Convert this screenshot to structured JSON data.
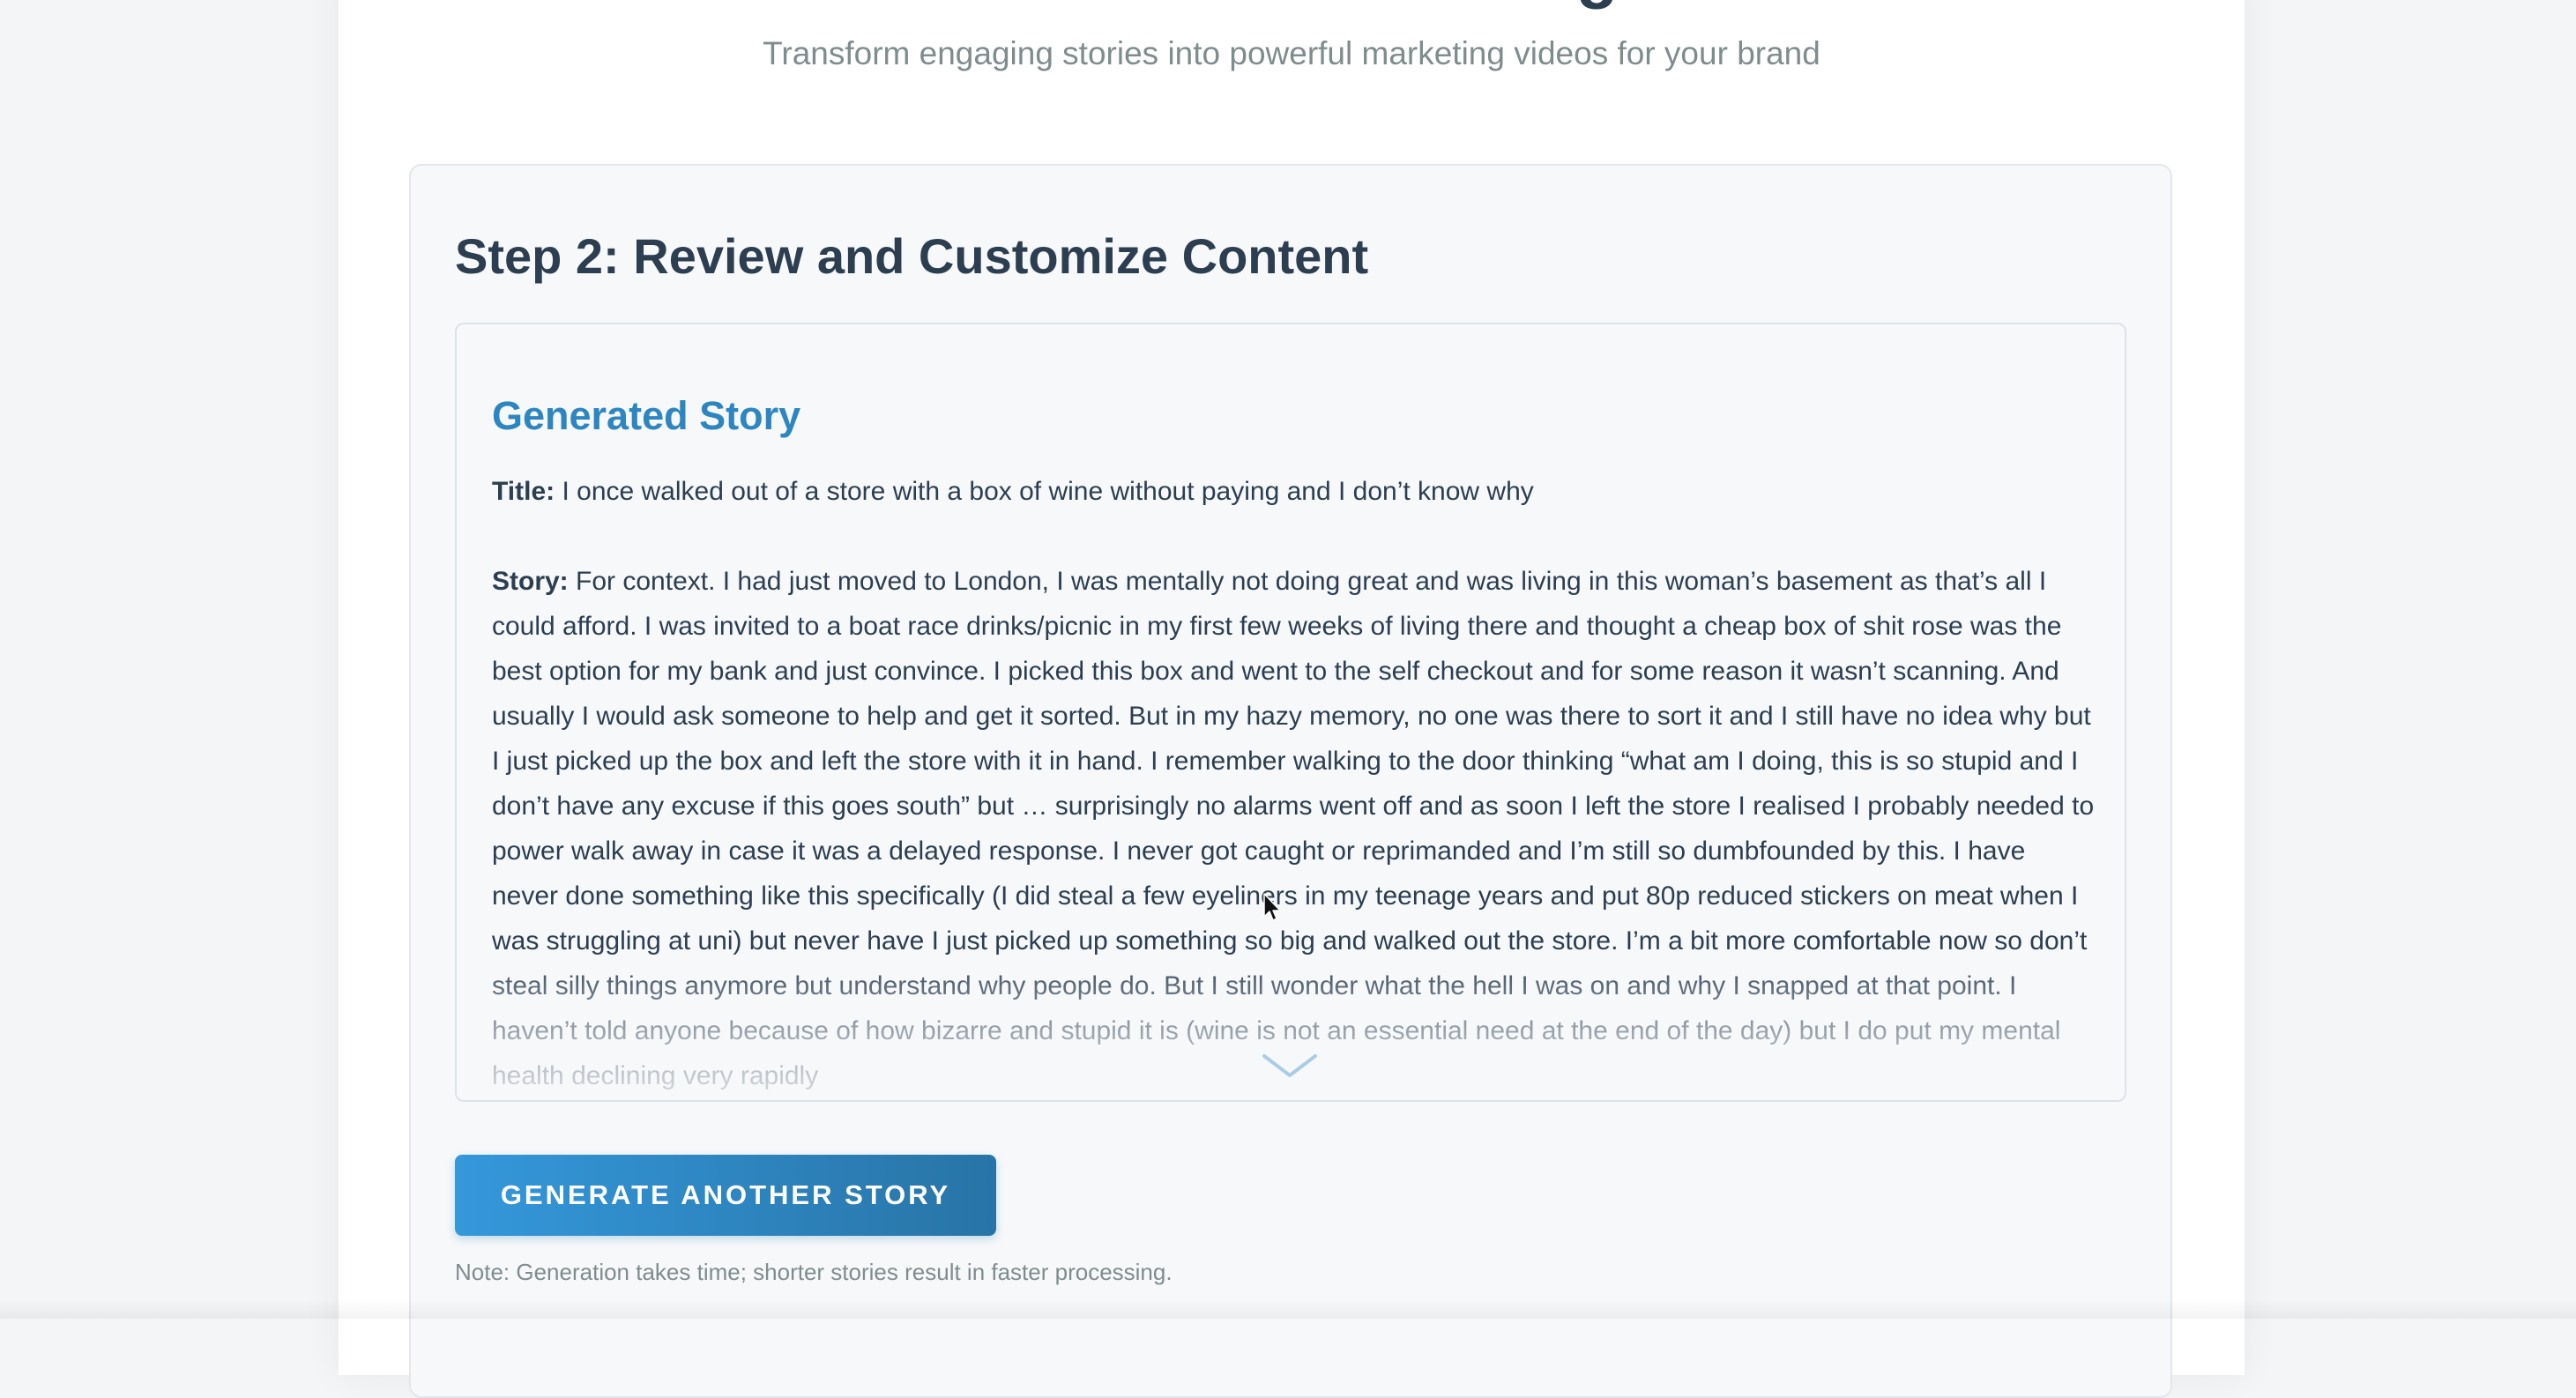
{
  "header": {
    "title": "AI-Powered Content Marketing Generator",
    "subtitle": "Transform engaging stories into powerful marketing videos for your brand"
  },
  "step": {
    "heading": "Step 2: Review and Customize Content"
  },
  "story": {
    "section_heading": "Generated Story",
    "title_label": "Title:",
    "title_value": "I once walked out of a store with a box of wine without paying and I don’t know why",
    "story_label": "Story:",
    "story_text": "For context. I had just moved to London, I was mentally not doing great and was living in this woman’s basement as that’s all I could afford. I was invited to a boat race drinks/picnic in my first few weeks of living there and thought a cheap box of shit rose was the best option for my bank and just convince. I picked this box and went to the self checkout and for some reason it wasn’t scanning. And usually I would ask someone to help and get it sorted. But in my hazy memory, no one was there to sort it and I still have no idea why but I just picked up the box and left the store with it in hand. I remember walking to the door thinking “what am I doing, this is so stupid and I don’t have any excuse if this goes south” but … surprisingly no alarms went off and as soon I left the store I realised I probably needed to power walk away in case it was a delayed response. I never got caught or reprimanded and I’m still so dumbfounded by this. I have never done something like this specifically (I did steal a few eyeliners in my teenage years and put 80p reduced stickers on meat when I was struggling at uni) but never have I just picked up something so big and walked out the store. I’m a bit more comfortable now so don’t steal silly things anymore but understand why people do. But I still wonder what the hell I was on and why I snapped at that point. I haven’t told anyone because of how bizarre and stupid it is (wine is not an essential need at the end of the day) but I do put my mental health declining very rapidly",
    "expand_icon": "chevron-down-icon"
  },
  "actions": {
    "generate_label": "Generate Another Story",
    "note": "Note: Generation takes time; shorter stories result in faster processing."
  },
  "colors": {
    "accent": "#2e86c1",
    "button_start": "#3498db",
    "button_end": "#2874a6",
    "text": "#2c3e50",
    "muted": "#7f8c8d"
  }
}
